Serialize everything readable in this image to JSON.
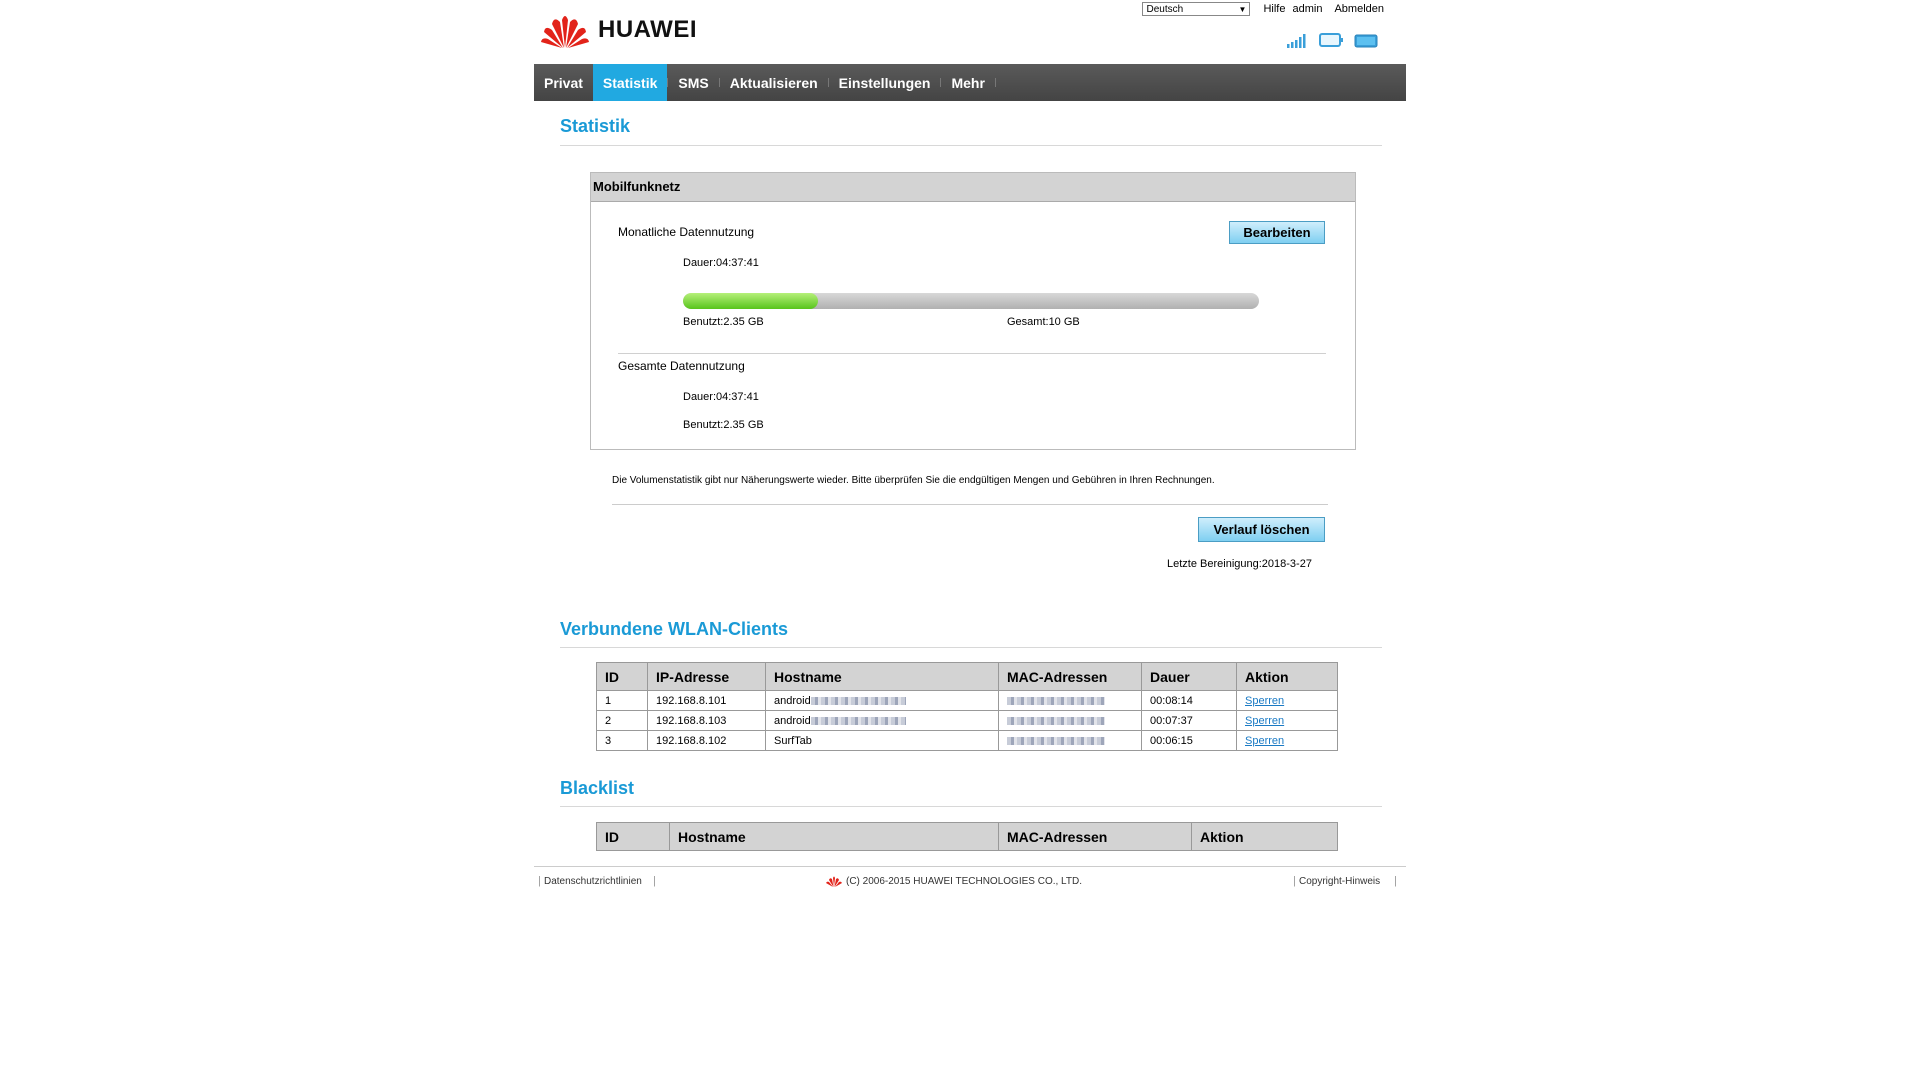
{
  "header": {
    "brand": "HUAWEI",
    "language": "Deutsch",
    "help": "Hilfe",
    "user": "admin",
    "logout": "Abmelden"
  },
  "nav": {
    "items": [
      "Privat",
      "Statistik",
      "SMS",
      "Aktualisieren",
      "Einstellungen",
      "Mehr"
    ],
    "active": "Statistik"
  },
  "statistics": {
    "title": "Statistik",
    "panel_title": "Mobilfunknetz",
    "monthly": {
      "label": "Monatliche Datennutzung",
      "duration": "Dauer:04:37:41",
      "used": "Benutzt:2.35 GB",
      "total": "Gesamt:10 GB",
      "usage_fraction": 0.235
    },
    "edit_button": "Bearbeiten",
    "overall": {
      "label": "Gesamte Datennutzung",
      "duration": "Dauer:04:37:41",
      "used": "Benutzt:2.35 GB"
    },
    "note": "Die Volumenstatistik gibt nur Näherungswerte wieder. Bitte überprüfen Sie die endgültigen Mengen und Gebühren in Ihren Rechnungen.",
    "clear_button": "Verlauf löschen",
    "last_cleared": "Letzte Bereinigung:2018-3-27"
  },
  "wlan": {
    "title": "Verbundene WLAN-Clients",
    "columns": [
      "ID",
      "IP-Adresse",
      "Hostname",
      "MAC-Adressen",
      "Dauer",
      "Aktion"
    ],
    "rows": [
      {
        "id": "1",
        "ip": "192.168.8.101",
        "hostname": "android",
        "duration": "00:08:14",
        "action": "Sperren"
      },
      {
        "id": "2",
        "ip": "192.168.8.103",
        "hostname": "android",
        "duration": "00:07:37",
        "action": "Sperren"
      },
      {
        "id": "3",
        "ip": "192.168.8.102",
        "hostname": "SurfTab",
        "duration": "00:06:15",
        "action": "Sperren"
      }
    ]
  },
  "blacklist": {
    "title": "Blacklist",
    "columns": [
      "ID",
      "Hostname",
      "MAC-Adressen",
      "Aktion"
    ]
  },
  "footer": {
    "privacy": "Datenschutzrichtlinien",
    "copyright": "(C) 2006-2015 HUAWEI TECHNOLOGIES CO., LTD.",
    "notice": "Copyright-Hinweis"
  },
  "colors": {
    "accent": "#21a9e1",
    "title": "#1a9ad6",
    "brand_red": "#e2231a",
    "progress": "#58c41b"
  },
  "icons": [
    "signal-icon",
    "monitor-icon",
    "battery-icon",
    "huawei-logo-icon",
    "chevron-down-icon"
  ]
}
